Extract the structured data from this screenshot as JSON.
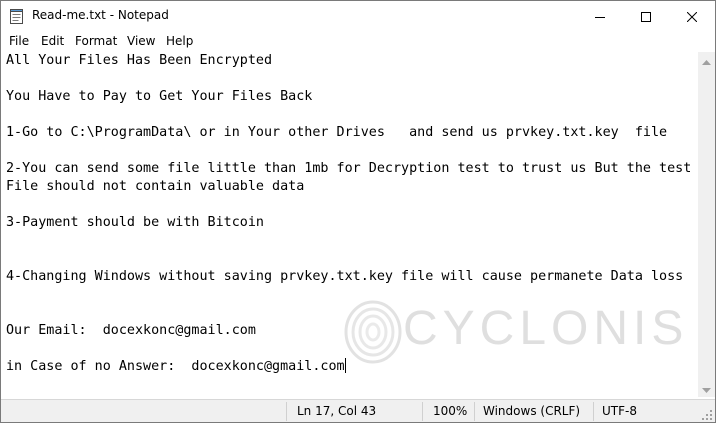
{
  "window": {
    "title": "Read-me.txt - Notepad"
  },
  "menu": {
    "file": "File",
    "edit": "Edit",
    "format": "Format",
    "view": "View",
    "help": "Help"
  },
  "editor": {
    "lines": [
      "All Your Files Has Been Encrypted",
      "You Have to Pay to Get Your Files Back",
      "1-Go to C:\\ProgramData\\ or in Your other Drives   and send us prvkey.txt.key  file",
      "2-You can send some file little than 1mb for Decryption test to trust us But the test",
      "File should not contain valuable data",
      "3-Payment should be with Bitcoin",
      "4-Changing Windows without saving prvkey.txt.key file will cause permanete Data loss",
      "Our Email:  docexkonc@gmail.com",
      "in Case of no Answer:  docexkonc@gmail.com"
    ]
  },
  "status": {
    "position": "Ln 17, Col 43",
    "zoom": "100%",
    "line_ending": "Windows (CRLF)",
    "encoding": "UTF-8"
  },
  "watermark": {
    "text": "CYCLONIS"
  },
  "icons": {
    "app": "notepad-icon",
    "minimize": "minimize-icon",
    "maximize": "maximize-icon",
    "close": "close-icon"
  }
}
